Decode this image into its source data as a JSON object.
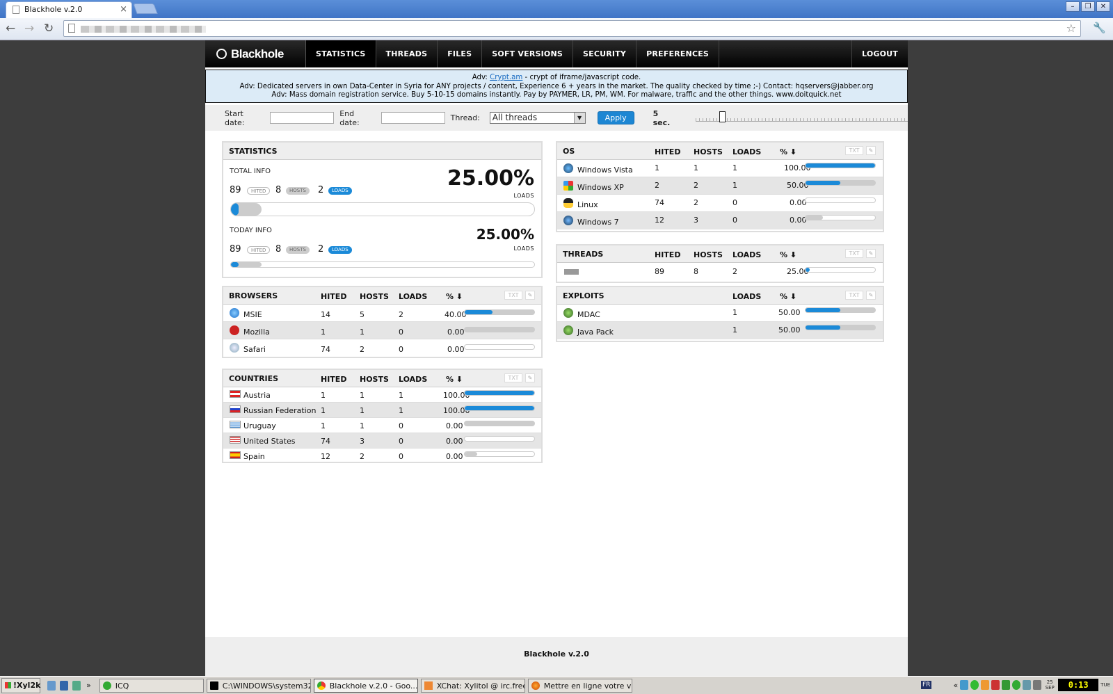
{
  "browser": {
    "tab_title": "Blackhole v.2.0",
    "tab_close": "×",
    "minimize": "–",
    "restore": "❐",
    "close": "✕"
  },
  "nav": {
    "logo": "Blackhole",
    "items": [
      "STATISTICS",
      "THREADS",
      "FILES",
      "SOFT VERSIONS",
      "SECURITY",
      "PREFERENCES"
    ],
    "logout": "LOGOUT"
  },
  "adv": {
    "line1_prefix": "Adv: ",
    "line1_link": "Crypt.am",
    "line1_suffix": " - crypt of iframe/javascript code.",
    "line2": "Adv: Dedicated servers in own Data-Center in Syria for ANY projects / content, Experience 6 + years in the market. The quality checked by time ;-) Contact: hqservers@jabber.org",
    "line3": "Adv: Mass domain registration service. Buy 5-10-15 domains instantly. Pay by PAYMER, LR, PM, WM. For malware, traffic and the other things. www.doitquick.net"
  },
  "filters": {
    "start_label": "Start date:",
    "end_label": "End date:",
    "thread_label": "Thread:",
    "thread_value": "All threads",
    "apply": "Apply",
    "refresh": "5 sec.",
    "refresh_level": 0.11
  },
  "stats": {
    "title": "STATISTICS",
    "total_label": "TOTAL INFO",
    "today_label": "TODAY INFO",
    "total": {
      "hited": "89",
      "hosts": "8",
      "loads": "2",
      "pct": "25.00%"
    },
    "today": {
      "hited": "89",
      "hosts": "8",
      "loads": "2",
      "pct": "25.00%"
    },
    "hited_tag": "HITED",
    "hosts_tag": "HOSTS",
    "loads_tag": "LOADS",
    "loads_caption": "LOADS"
  },
  "cols": {
    "hited": "HITED",
    "hosts": "HOSTS",
    "loads": "LOADS",
    "pct": "% ⬇",
    "txt": "TXT",
    "tool": "✎"
  },
  "browsers": {
    "title": "BROWSERS",
    "rows": [
      {
        "name": "MSIE",
        "hited": "14",
        "hosts": "5",
        "loads": "2",
        "pct": "40.00",
        "fill": 0.4
      },
      {
        "name": "Mozilla",
        "hited": "1",
        "hosts": "1",
        "loads": "0",
        "pct": "0.00",
        "fill": 0
      },
      {
        "name": "Safari",
        "hited": "74",
        "hosts": "2",
        "loads": "0",
        "pct": "0.00",
        "fill": 0
      }
    ]
  },
  "countries": {
    "title": "COUNTRIES",
    "rows": [
      {
        "name": "Austria",
        "hited": "1",
        "hosts": "1",
        "loads": "1",
        "pct": "100.00",
        "fill": 1
      },
      {
        "name": "Russian Federation",
        "hited": "1",
        "hosts": "1",
        "loads": "1",
        "pct": "100.00",
        "fill": 1
      },
      {
        "name": "Uruguay",
        "hited": "1",
        "hosts": "1",
        "loads": "0",
        "pct": "0.00",
        "fill": 0
      },
      {
        "name": "United States",
        "hited": "74",
        "hosts": "3",
        "loads": "0",
        "pct": "0.00",
        "fill": 0
      },
      {
        "name": "Spain",
        "hited": "12",
        "hosts": "2",
        "loads": "0",
        "pct": "0.00",
        "fill": 0
      }
    ]
  },
  "os": {
    "title": "OS",
    "rows": [
      {
        "name": "Windows Vista",
        "hited": "1",
        "hosts": "1",
        "loads": "1",
        "pct": "100.00",
        "fill": 1
      },
      {
        "name": "Windows XP",
        "hited": "2",
        "hosts": "2",
        "loads": "1",
        "pct": "50.00",
        "fill": 0.5
      },
      {
        "name": "Linux",
        "hited": "74",
        "hosts": "2",
        "loads": "0",
        "pct": "0.00",
        "fill": 0
      },
      {
        "name": "Windows 7",
        "hited": "12",
        "hosts": "3",
        "loads": "0",
        "pct": "0.00",
        "fill": 0
      }
    ]
  },
  "threads": {
    "title": "THREADS",
    "rows": [
      {
        "hited": "89",
        "hosts": "8",
        "loads": "2",
        "pct": "25.00",
        "fill": 0.25
      }
    ]
  },
  "exploits": {
    "title": "EXPLOITS",
    "rows": [
      {
        "name": "MDAC",
        "loads": "1",
        "pct": "50.00",
        "fill": 0.5
      },
      {
        "name": "Java Pack",
        "loads": "1",
        "pct": "50.00",
        "fill": 0.5
      }
    ]
  },
  "footer": "Blackhole v.2.0",
  "taskbar": {
    "start": "!Xyl2k",
    "items": [
      "ICQ",
      "C:\\WINDOWS\\system32...",
      "Blackhole v.2.0 - Goo...",
      "XChat: Xylitol @ irc.free...",
      "Mettre en ligne votre vid..."
    ],
    "lang": "FR",
    "tray_more": "«",
    "clock": "0:13",
    "date": "25 SEP",
    "day": "TUE"
  },
  "colors": {
    "accent": "#1b8ad8",
    "nav_bg": "#000000",
    "adv_bg": "#dcebf7"
  }
}
